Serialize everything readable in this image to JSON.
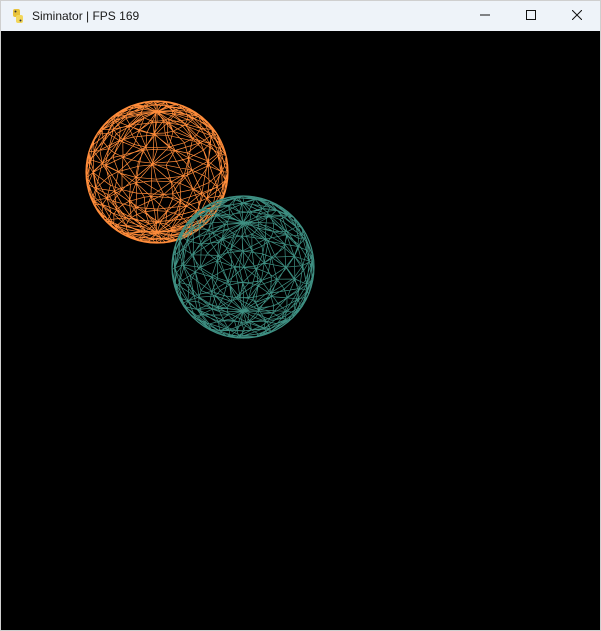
{
  "window": {
    "title": "Siminator | FPS 169",
    "app_icon": "python-snake-icon"
  },
  "controls": {
    "minimize_icon": "minimize-icon",
    "maximize_icon": "maximize-icon",
    "close_icon": "close-icon"
  },
  "scene": {
    "background": "#000000",
    "spheres": [
      {
        "name": "orange-wireframe-sphere",
        "color": "#ff8c3a"
      },
      {
        "name": "teal-wireframe-sphere",
        "color": "#3e8f82"
      }
    ]
  }
}
